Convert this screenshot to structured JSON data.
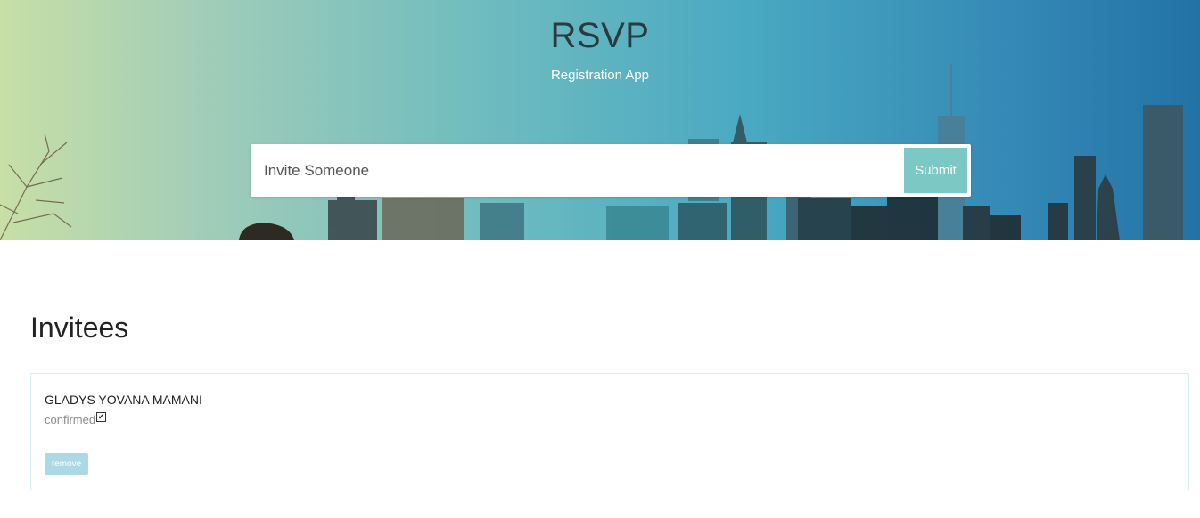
{
  "header": {
    "title": "RSVP",
    "subtitle": "Registration App"
  },
  "form": {
    "placeholder": "Invite Someone",
    "submit_label": "Submit"
  },
  "invitees": {
    "heading": "Invitees",
    "items": [
      {
        "name": "GLADYS YOVANA MAMANI",
        "confirmed_label": "confirmed",
        "confirmed": true,
        "remove_label": "remove"
      }
    ]
  },
  "colors": {
    "accent": "#7bc8c4",
    "remove_button": "#add9e4"
  }
}
